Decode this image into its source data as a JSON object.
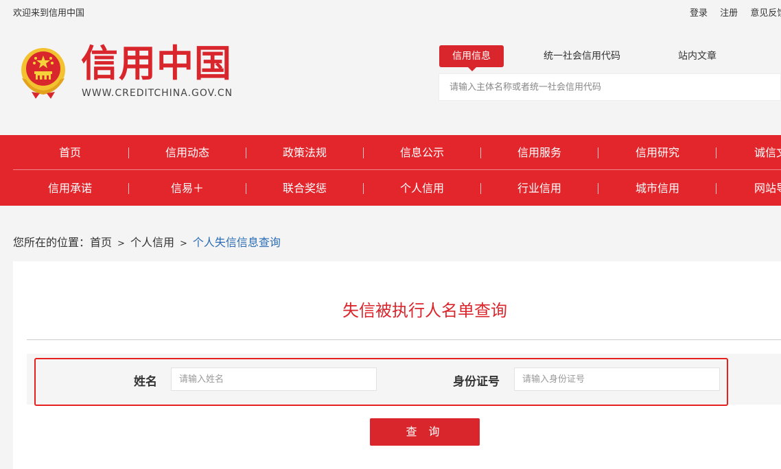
{
  "topbar": {
    "welcome": "欢迎来到信用中国",
    "links": [
      "登录",
      "注册",
      "意见反馈"
    ]
  },
  "header": {
    "logo_text": "信用中国",
    "logo_url": "WWW.CREDITCHINA.GOV.CN",
    "emblem_icon": "national-emblem-icon"
  },
  "search": {
    "tabs": [
      "信用信息",
      "统一社会信用代码",
      "站内文章"
    ],
    "active_tab": "信用信息",
    "placeholder": "请输入主体名称或者统一社会信用代码"
  },
  "nav": {
    "row1": [
      "首页",
      "信用动态",
      "政策法规",
      "信息公示",
      "信用服务",
      "信用研究",
      "诚信文化"
    ],
    "row2": [
      "信用承诺",
      "信易＋",
      "联合奖惩",
      "个人信用",
      "行业信用",
      "城市信用",
      "网站导航"
    ]
  },
  "breadcrumb": {
    "prefix": "您所在的位置：",
    "items": [
      "首页",
      "个人信用"
    ],
    "separator": ">",
    "current": "个人失信信息查询"
  },
  "form": {
    "title": "失信被执行人名单查询",
    "name_label": "姓名",
    "name_placeholder": "请输入姓名",
    "id_label": "身份证号",
    "id_placeholder": "请输入身份证号",
    "submit_label": "查 询"
  },
  "colors": {
    "brand_red": "#d9262c",
    "nav_red": "#e3262c",
    "link_blue": "#2a6cb5"
  }
}
